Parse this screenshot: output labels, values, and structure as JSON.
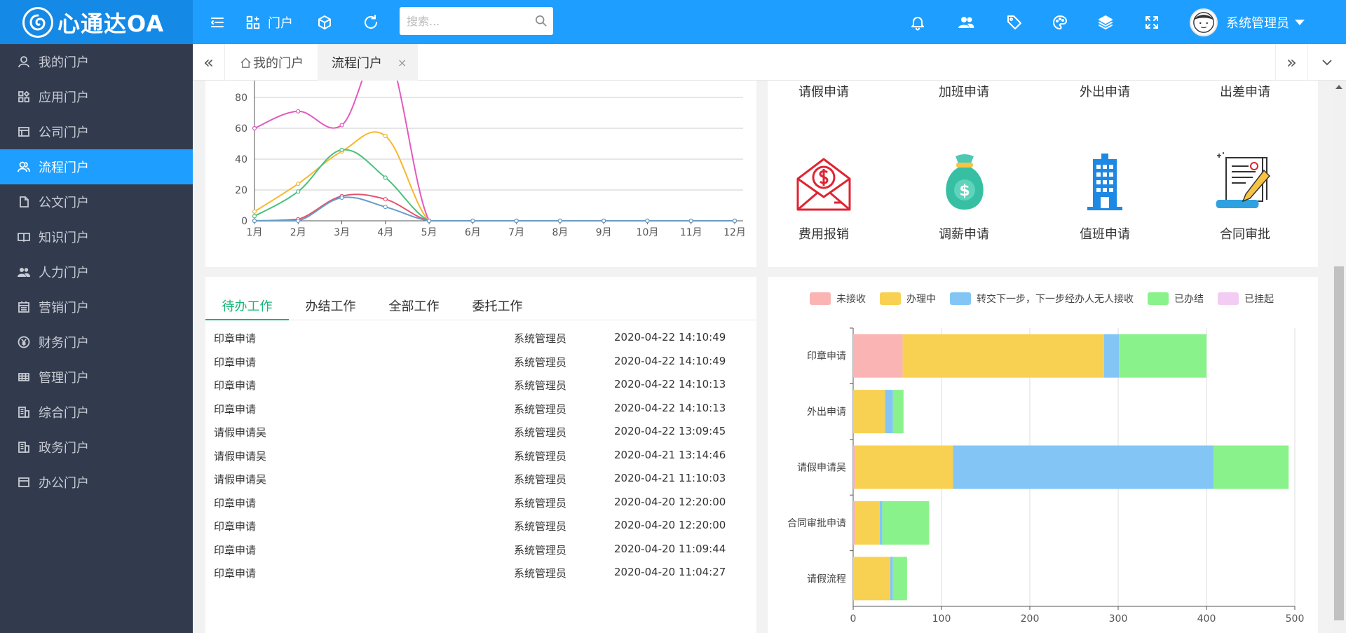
{
  "header": {
    "brand": "心通达OA",
    "portal_label": "门户",
    "search_placeholder": "搜索...",
    "user_name": "系统管理员"
  },
  "sidebar": {
    "items": [
      {
        "label": "我的门户",
        "icon": "user-icon"
      },
      {
        "label": "应用门户",
        "icon": "apps-icon"
      },
      {
        "label": "公司门户",
        "icon": "window-icon"
      },
      {
        "label": "流程门户",
        "icon": "users-icon",
        "active": true
      },
      {
        "label": "公文门户",
        "icon": "document-icon"
      },
      {
        "label": "知识门户",
        "icon": "book-icon"
      },
      {
        "label": "人力门户",
        "icon": "people-icon"
      },
      {
        "label": "营销门户",
        "icon": "calendar-icon"
      },
      {
        "label": "财务门户",
        "icon": "yen-icon"
      },
      {
        "label": "管理门户",
        "icon": "grid-icon"
      },
      {
        "label": "综合门户",
        "icon": "building-icon"
      },
      {
        "label": "政务门户",
        "icon": "building-icon"
      },
      {
        "label": "办公门户",
        "icon": "window-icon"
      }
    ]
  },
  "tabs": [
    {
      "label": "我的门户",
      "icon": "home-icon"
    },
    {
      "label": "流程门户",
      "active": true,
      "close": "×"
    }
  ],
  "apps_top": [
    "请假申请",
    "加班申请",
    "外出申请",
    "出差申请"
  ],
  "apps_bottom": [
    {
      "label": "费用报销",
      "icon": "envelope-dollar-icon"
    },
    {
      "label": "调薪申请",
      "icon": "money-bag-icon"
    },
    {
      "label": "值班申请",
      "icon": "building-icon"
    },
    {
      "label": "合同审批",
      "icon": "contract-pen-icon"
    }
  ],
  "work_tabs": [
    "待办工作",
    "办结工作",
    "全部工作",
    "委托工作"
  ],
  "work_rows": [
    {
      "title": "印章申请",
      "user": "系统管理员",
      "time": "2020-04-22 14:10:49"
    },
    {
      "title": "印章申请",
      "user": "系统管理员",
      "time": "2020-04-22 14:10:49"
    },
    {
      "title": "印章申请",
      "user": "系统管理员",
      "time": "2020-04-22 14:10:13"
    },
    {
      "title": "印章申请",
      "user": "系统管理员",
      "time": "2020-04-22 14:10:13"
    },
    {
      "title": "请假申请吴",
      "user": "系统管理员",
      "time": "2020-04-22 13:09:45"
    },
    {
      "title": "请假申请吴",
      "user": "系统管理员",
      "time": "2020-04-21 13:14:46"
    },
    {
      "title": "请假申请吴",
      "user": "系统管理员",
      "time": "2020-04-21 11:10:03"
    },
    {
      "title": "印章申请",
      "user": "系统管理员",
      "time": "2020-04-20 12:20:00"
    },
    {
      "title": "印章申请",
      "user": "系统管理员",
      "time": "2020-04-20 12:20:00"
    },
    {
      "title": "印章申请",
      "user": "系统管理员",
      "time": "2020-04-20 11:09:44"
    },
    {
      "title": "印章申请",
      "user": "系统管理员",
      "time": "2020-04-20 11:04:27"
    }
  ],
  "chart_data": [
    {
      "type": "line",
      "categories": [
        "1月",
        "2月",
        "3月",
        "4月",
        "5月",
        "6月",
        "7月",
        "8月",
        "9月",
        "10月",
        "11月",
        "12月"
      ],
      "ylim": [
        0,
        80
      ],
      "yticks": [
        0,
        20,
        40,
        60,
        80
      ],
      "smooth": true,
      "grid": true,
      "series": [
        {
          "color": "#e25ac0",
          "values": [
            60,
            71,
            62,
            112,
            0,
            0,
            0,
            0,
            0,
            0,
            0,
            0
          ]
        },
        {
          "color": "#f7b731",
          "values": [
            6,
            24,
            45,
            55,
            0,
            0,
            0,
            0,
            0,
            0,
            0,
            0
          ]
        },
        {
          "color": "#4cbf7e",
          "values": [
            3,
            19,
            46,
            28,
            0,
            0,
            0,
            0,
            0,
            0,
            0,
            0
          ]
        },
        {
          "color": "#e2546e",
          "values": [
            0,
            1,
            16,
            14,
            0,
            0,
            0,
            0,
            0,
            0,
            0,
            0
          ]
        },
        {
          "color": "#6a9bc7",
          "values": [
            0,
            0,
            15,
            9,
            0,
            0,
            0,
            0,
            0,
            0,
            0,
            0
          ]
        }
      ]
    },
    {
      "type": "bar",
      "orientation": "horizontal",
      "stacked": true,
      "categories": [
        "印章申请",
        "外出申请",
        "请假申请吴",
        "合同审批申请",
        "请假流程"
      ],
      "xlim": [
        0,
        500
      ],
      "xticks": [
        0,
        100,
        200,
        300,
        400,
        500
      ],
      "legend_position": "top",
      "series": [
        {
          "name": "未接收",
          "color": "#fbb4b4",
          "values": [
            56,
            0,
            3,
            3,
            0
          ]
        },
        {
          "name": "办理中",
          "color": "#f9d152",
          "values": [
            228,
            36,
            110,
            27,
            42
          ]
        },
        {
          "name": "转交下一步，下一步经办人无人接收",
          "color": "#83c6f5",
          "values": [
            17,
            9,
            295,
            3,
            3
          ]
        },
        {
          "name": "已办结",
          "color": "#8af28a",
          "values": [
            99,
            12,
            85,
            53,
            16
          ]
        },
        {
          "name": "已挂起",
          "color": "#f3ccf4",
          "values": [
            0,
            0,
            0,
            0,
            0
          ]
        }
      ]
    }
  ]
}
